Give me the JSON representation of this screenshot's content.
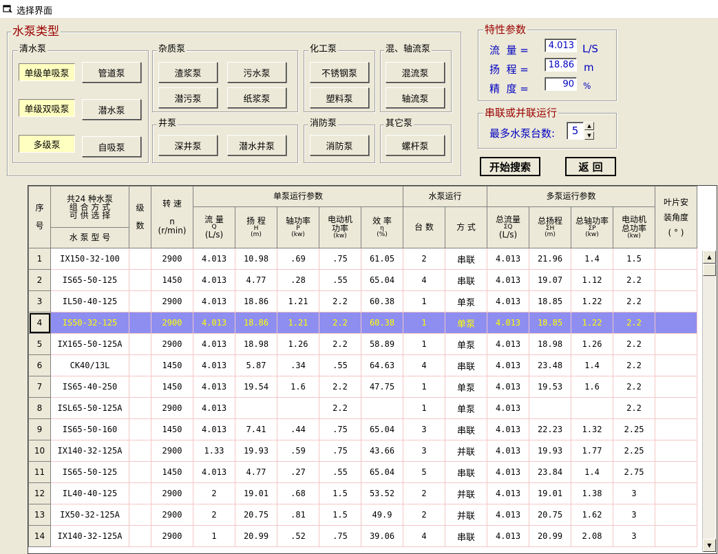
{
  "window": {
    "title": "选择界面"
  },
  "pump_types": {
    "title": "水泵类型",
    "clear": {
      "title": "清水泵",
      "items": [
        "单级单吸泵",
        "单级双吸泵",
        "多级泵"
      ],
      "buttons": [
        "管道泵",
        "潜水泵",
        "自吸泵"
      ]
    },
    "impurity": {
      "title": "杂质泵",
      "buttons": [
        "渣浆泵",
        "污水泵",
        "潜污泵",
        "纸浆泵"
      ]
    },
    "well": {
      "title": "井泵",
      "buttons": [
        "深井泵",
        "潜水井泵"
      ]
    },
    "chemical": {
      "title": "化工泵",
      "buttons": [
        "不锈钢泵",
        "塑料泵"
      ]
    },
    "mixed": {
      "title": "混、轴流泵",
      "buttons": [
        "混流泵",
        "轴流泵"
      ]
    },
    "fire": {
      "title": "消防泵",
      "buttons": [
        "消防泵"
      ]
    },
    "other": {
      "title": "其它泵",
      "buttons": [
        "螺杆泵"
      ]
    }
  },
  "params": {
    "title": "特性参数",
    "flow_label": "流  量 =",
    "flow_value": "4.013",
    "flow_unit": "L/S",
    "head_label": "扬  程 =",
    "head_value": "18.86",
    "head_unit": "m",
    "accuracy_label": "精  度 =",
    "accuracy_value": "90",
    "accuracy_unit": "%"
  },
  "series": {
    "title": "串联或并联运行",
    "max_label": "最多水泵台数:",
    "max_value": "5"
  },
  "actions": {
    "search": "开始搜索",
    "back": "返  回"
  },
  "table": {
    "headers": {
      "seq_top": "序",
      "seq_bottom": "号",
      "combo1": "共24 种水泵",
      "combo2": "组 合 方 式",
      "combo3": "可 供 选 择",
      "model": "水 泵 型 号",
      "stage1": "级",
      "stage2": "数",
      "speed1": "转  速",
      "speed2": "n",
      "speed3": "(r/min)",
      "single": "单泵运行参数",
      "q1": "流  量",
      "q2": "Q",
      "q3": "(L/s)",
      "h1": "扬  程",
      "h2": "H",
      "h3": "(m)",
      "p1": "轴功率",
      "p2": "P",
      "p3": "(kw)",
      "m1": "电动机",
      "m2": "功率",
      "m3": "(kw)",
      "e1": "效  率",
      "e2": "η",
      "e3": "(%)",
      "run": "水泵运行",
      "count": "台  数",
      "mode": "方  式",
      "multi": "多泵运行参数",
      "tq1": "总流量",
      "tq2": "ΣQ",
      "tq3": "(L/s)",
      "th1": "总扬程",
      "th2": "ΣH",
      "th3": "(m)",
      "tp1": "总轴功率",
      "tp2": "ΣP",
      "tp3": "(kw)",
      "tm1": "电动机",
      "tm2": "总功率",
      "tm3": "(kw)",
      "angle1": "叶片安",
      "angle2": "装角度",
      "angle3": "( ° )"
    },
    "rows": [
      {
        "n": "1",
        "model": "IX150-32-100",
        "stage": "",
        "speed": "2900",
        "q": "4.013",
        "h": "10.98",
        "p": ".69",
        "m": ".75",
        "e": "61.05",
        "count": "2",
        "mode": "串联",
        "tq": "4.013",
        "th": "21.96",
        "tp": "1.4",
        "tm": "1.5",
        "angle": ""
      },
      {
        "n": "2",
        "model": "IS65-50-125",
        "stage": "",
        "speed": "1450",
        "q": "4.013",
        "h": "4.77",
        "p": ".28",
        "m": ".55",
        "e": "65.04",
        "count": "4",
        "mode": "串联",
        "tq": "4.013",
        "th": "19.07",
        "tp": "1.12",
        "tm": "2.2",
        "angle": ""
      },
      {
        "n": "3",
        "model": "IL50-40-125",
        "stage": "",
        "speed": "2900",
        "q": "4.013",
        "h": "18.86",
        "p": "1.21",
        "m": "2.2",
        "e": "60.38",
        "count": "1",
        "mode": "单泵",
        "tq": "4.013",
        "th": "18.85",
        "tp": "1.22",
        "tm": "2.2",
        "angle": ""
      },
      {
        "n": "4",
        "model": "IS50-32-125",
        "stage": "",
        "speed": "2900",
        "q": "4.013",
        "h": "18.86",
        "p": "1.21",
        "m": "2.2",
        "e": "60.38",
        "count": "1",
        "mode": "单泵",
        "tq": "4.013",
        "th": "18.85",
        "tp": "1.22",
        "tm": "2.2",
        "angle": ""
      },
      {
        "n": "5",
        "model": "IX165-50-125A",
        "stage": "",
        "speed": "2900",
        "q": "4.013",
        "h": "18.98",
        "p": "1.26",
        "m": "2.2",
        "e": "58.89",
        "count": "1",
        "mode": "单泵",
        "tq": "4.013",
        "th": "18.98",
        "tp": "1.26",
        "tm": "2.2",
        "angle": ""
      },
      {
        "n": "6",
        "model": "CK40/13L",
        "stage": "",
        "speed": "1450",
        "q": "4.013",
        "h": "5.87",
        "p": ".34",
        "m": ".55",
        "e": "64.63",
        "count": "4",
        "mode": "串联",
        "tq": "4.013",
        "th": "23.48",
        "tp": "1.4",
        "tm": "2.2",
        "angle": ""
      },
      {
        "n": "7",
        "model": "IS65-40-250",
        "stage": "",
        "speed": "1450",
        "q": "4.013",
        "h": "19.54",
        "p": "1.6",
        "m": "2.2",
        "e": "47.75",
        "count": "1",
        "mode": "单泵",
        "tq": "4.013",
        "th": "19.53",
        "tp": "1.6",
        "tm": "2.2",
        "angle": ""
      },
      {
        "n": "8",
        "model": "ISL65-50-125A",
        "stage": "",
        "speed": "2900",
        "q": "4.013",
        "h": "",
        "p": "",
        "m": "2.2",
        "e": "",
        "count": "1",
        "mode": "单泵",
        "tq": "4.013",
        "th": "",
        "tp": "",
        "tm": "2.2",
        "angle": ""
      },
      {
        "n": "9",
        "model": "IS65-50-160",
        "stage": "",
        "speed": "1450",
        "q": "4.013",
        "h": "7.41",
        "p": ".44",
        "m": ".75",
        "e": "65.04",
        "count": "3",
        "mode": "串联",
        "tq": "4.013",
        "th": "22.23",
        "tp": "1.32",
        "tm": "2.25",
        "angle": ""
      },
      {
        "n": "10",
        "model": "IX140-32-125A",
        "stage": "",
        "speed": "2900",
        "q": "1.33",
        "h": "19.93",
        "p": ".59",
        "m": ".75",
        "e": "43.66",
        "count": "3",
        "mode": "并联",
        "tq": "4.013",
        "th": "19.93",
        "tp": "1.77",
        "tm": "2.25",
        "angle": ""
      },
      {
        "n": "11",
        "model": "IS65-50-125",
        "stage": "",
        "speed": "1450",
        "q": "4.013",
        "h": "4.77",
        "p": ".27",
        "m": ".55",
        "e": "65.04",
        "count": "5",
        "mode": "串联",
        "tq": "4.013",
        "th": "23.84",
        "tp": "1.4",
        "tm": "2.75",
        "angle": ""
      },
      {
        "n": "12",
        "model": "IL40-40-125",
        "stage": "",
        "speed": "2900",
        "q": "2",
        "h": "19.01",
        "p": ".68",
        "m": "1.5",
        "e": "53.52",
        "count": "2",
        "mode": "并联",
        "tq": "4.013",
        "th": "19.01",
        "tp": "1.38",
        "tm": "3",
        "angle": ""
      },
      {
        "n": "13",
        "model": "IX50-32-125A",
        "stage": "",
        "speed": "2900",
        "q": "2",
        "h": "20.75",
        "p": ".81",
        "m": "1.5",
        "e": "49.9",
        "count": "2",
        "mode": "并联",
        "tq": "4.013",
        "th": "20.75",
        "tp": "1.62",
        "tm": "3",
        "angle": ""
      },
      {
        "n": "14",
        "model": "IX140-32-125A",
        "stage": "",
        "speed": "2900",
        "q": "1",
        "h": "20.99",
        "p": ".52",
        "m": ".75",
        "e": "39.06",
        "count": "4",
        "mode": "串联",
        "tq": "4.013",
        "th": "20.99",
        "tp": "2.08",
        "tm": "3",
        "angle": ""
      }
    ],
    "selected_row": "4"
  }
}
